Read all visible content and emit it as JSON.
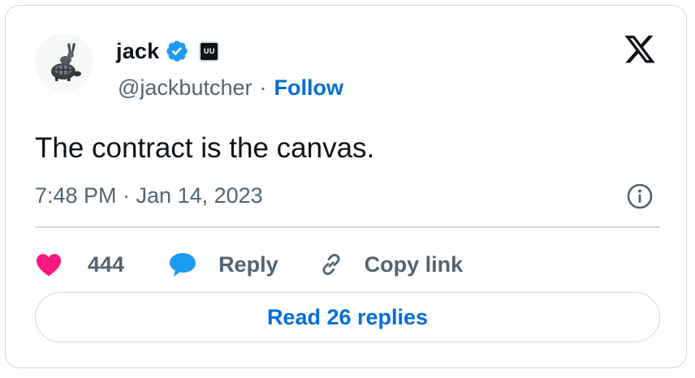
{
  "author": {
    "name": "jack",
    "handle": "@jackbutcher",
    "affiliate_badge": "UU",
    "follow_label": "Follow",
    "separator": "·"
  },
  "tweet": {
    "text": "The contract is the canvas.",
    "timestamp": "7:48 PM · Jan 14, 2023"
  },
  "actions": {
    "like_count": "444",
    "reply_label": "Reply",
    "copy_label": "Copy link"
  },
  "read_replies_label": "Read 26 replies",
  "icons": {
    "logo": "x-logo-icon",
    "verified": "verified-badge-icon",
    "info": "info-icon",
    "like": "heart-icon",
    "reply": "speech-bubble-icon",
    "copy": "link-icon"
  },
  "colors": {
    "accent": "#006fd6",
    "verified": "#1d9bf0",
    "like": "#f91880",
    "text": "#0f1419",
    "muted": "#536471",
    "border": "#cfd9de"
  }
}
